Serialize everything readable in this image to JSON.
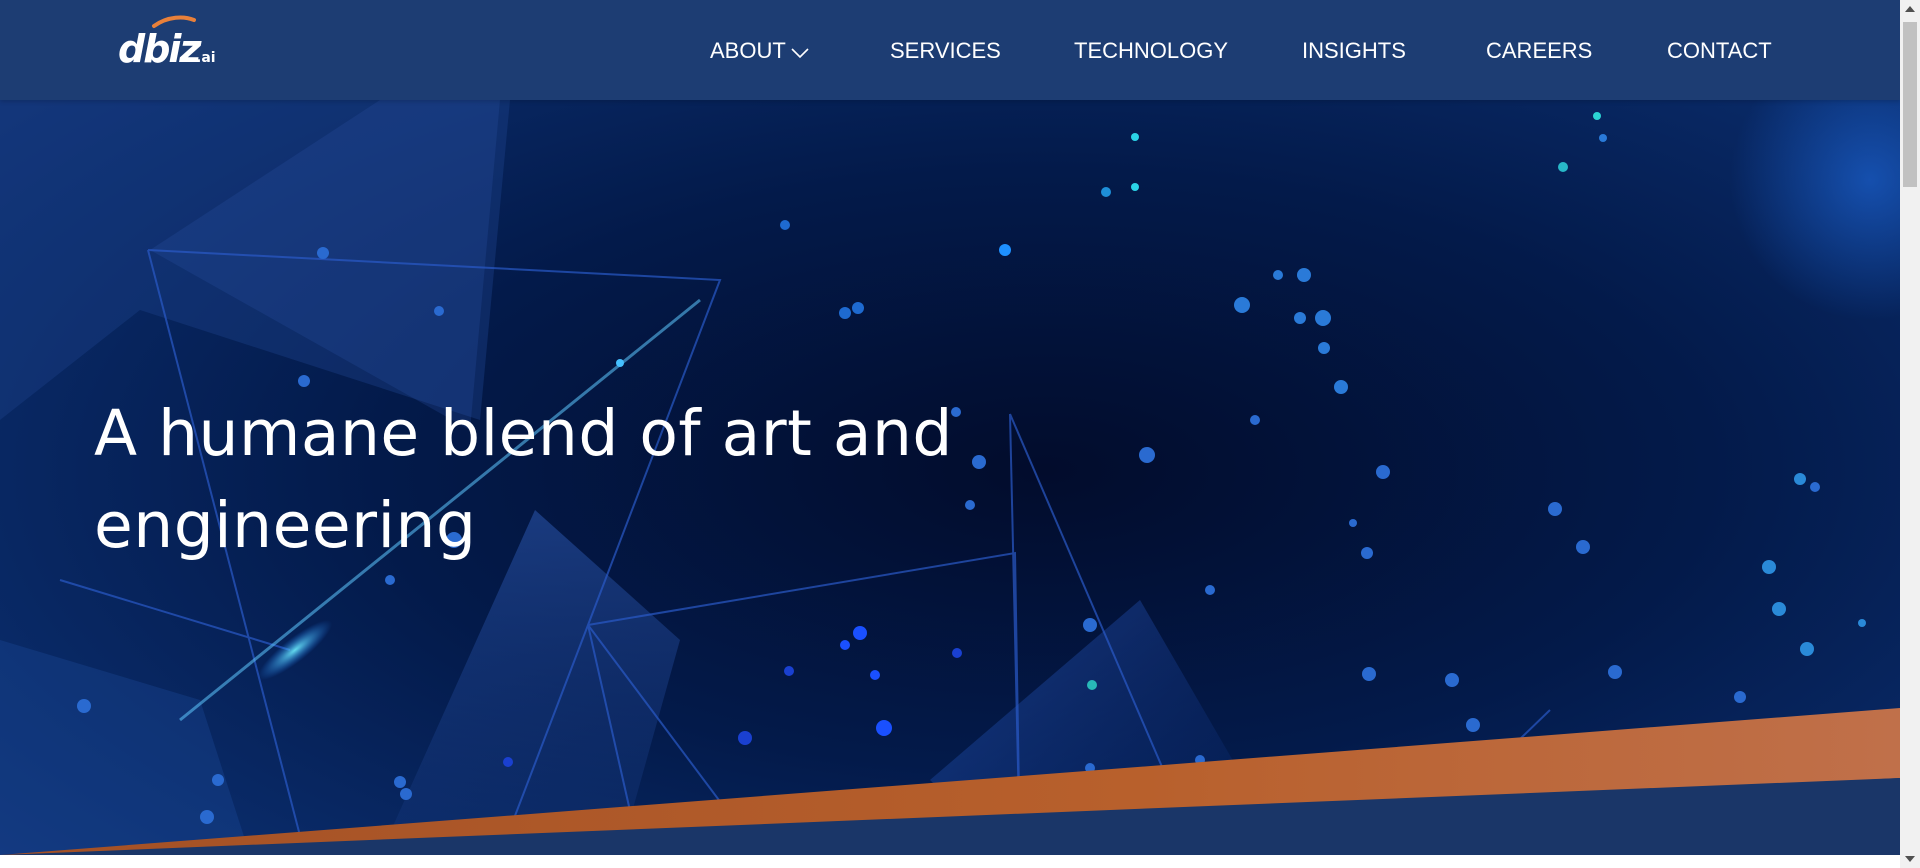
{
  "brand": {
    "logo_text": "dbiz",
    "logo_suffix": ".ai",
    "logo_accent_color": "#e8803a"
  },
  "nav": {
    "items": [
      {
        "label": "ABOUT",
        "has_dropdown": true
      },
      {
        "label": "SERVICES"
      },
      {
        "label": "TECHNOLOGY"
      },
      {
        "label": "INSIGHTS"
      },
      {
        "label": "CAREERS"
      },
      {
        "label": "CONTACT"
      }
    ]
  },
  "hero": {
    "headline_line1": "A humane blend of art and",
    "headline_line2": "engineering"
  },
  "colors": {
    "header_bg": "#1d3d73",
    "hero_dark": "#020c2c",
    "accent_orange": "#b8602c",
    "text": "#ffffff"
  }
}
